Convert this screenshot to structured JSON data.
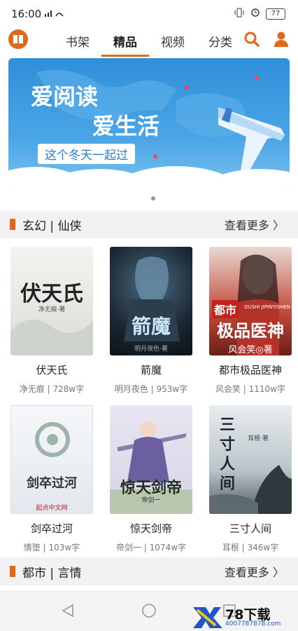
{
  "status": {
    "time": "16:00",
    "signal": "″ᵢₗ∥",
    "battery": "77"
  },
  "nav": {
    "tabs": [
      "书架",
      "精品",
      "视频",
      "分类"
    ],
    "active": "精品"
  },
  "banner": {
    "line1": "爱阅读",
    "line2": "爱生活",
    "tagline": "这个冬天一起过"
  },
  "sections": [
    {
      "title": "玄幻 | 仙侠",
      "more": "查看更多 〉"
    },
    {
      "title": "都市 | 言情",
      "more": "查看更多 〉"
    }
  ],
  "books": [
    {
      "title": "伏天氏",
      "meta": "净无痕 | 728w字",
      "cover_text": "伏天氏",
      "cover_sub": "净无痕·著"
    },
    {
      "title": "箭魔",
      "meta": "明月夜色 | 953w字",
      "cover_text": "箭魔",
      "cover_sub": "明月夜色·著"
    },
    {
      "title": "都市极品医神",
      "meta": "风会笑 | 1110w字",
      "cover_text": "极品医神",
      "cover_sub": "风会笑◎著",
      "cover_top": "都市",
      "cover_pinyin": "DUSHI JIPINYISHEN"
    },
    {
      "title": "剑卒过河",
      "meta": "情堕 | 103w字",
      "cover_text": "剑卒过河",
      "cover_sub": "起点中文网"
    },
    {
      "title": "惊天剑帝",
      "meta": "帝剑一 | 1074w字",
      "cover_text": "惊天剑帝",
      "cover_sub": "帝剑一"
    },
    {
      "title": "三寸人间",
      "meta": "耳根 | 346w字",
      "cover_text": "三寸人间",
      "cover_sub": "耳根·著"
    }
  ],
  "watermark": {
    "logo": "78下载",
    "url": "4007787878.com"
  },
  "colors": {
    "accent": "#e06a1c",
    "banner": "#3a98df"
  },
  "icons": [
    "book-logo-icon",
    "search-icon",
    "user-icon",
    "bookmark-icon",
    "back-icon",
    "home-icon",
    "recent-icon"
  ]
}
